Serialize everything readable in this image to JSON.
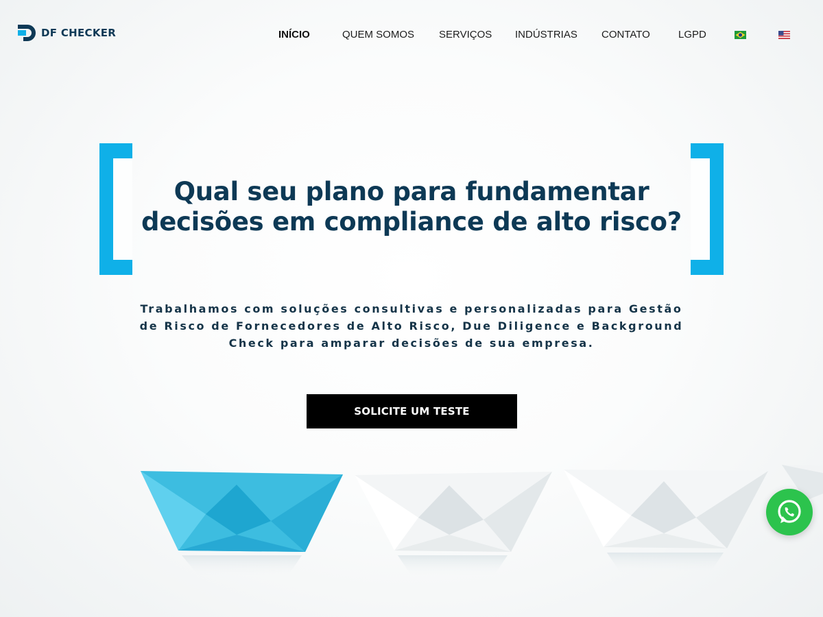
{
  "brand": {
    "name": "DF CHECKER",
    "logo_color": "#0e3956",
    "accent_color": "#0fb0e8"
  },
  "nav": {
    "items": [
      {
        "label": "INÍCIO",
        "active": true
      },
      {
        "label": "QUEM SOMOS",
        "active": false
      },
      {
        "label": "SERVIÇOS",
        "active": false
      },
      {
        "label": "INDÚSTRIAS",
        "active": false
      },
      {
        "label": "CONTATO",
        "active": false
      },
      {
        "label": "LGPD",
        "active": false
      }
    ],
    "languages": [
      {
        "icon": "brazil-flag-icon"
      },
      {
        "icon": "us-flag-icon"
      }
    ]
  },
  "hero": {
    "headline_line1": "Qual seu plano para fundamentar",
    "headline_line2": "decisões em compliance de alto risco?",
    "subtitle_line1": "Trabalhamos com soluções consultivas e personalizadas para Gestão",
    "subtitle_line2": "de Risco de Fornecedores de Alto Risco, Due Diligence e Background",
    "subtitle_line3": "Check para amparar decisões de sua empresa.",
    "cta_label": "SOLICITE UM TESTE",
    "headline_color": "#0d3955"
  },
  "floating": {
    "whatsapp_icon": "whatsapp-icon",
    "whatsapp_color": "#2cc34d"
  }
}
